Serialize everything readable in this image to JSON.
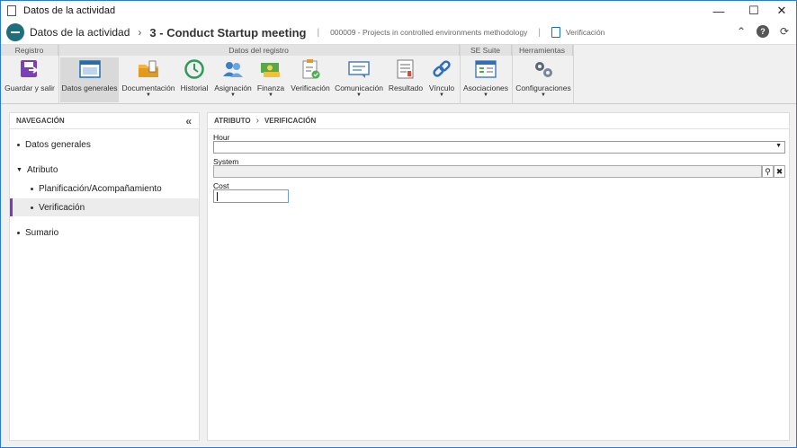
{
  "window": {
    "title": "Datos de la actividad"
  },
  "header": {
    "breadcrumb_root": "Datos de la actividad",
    "record_title": "3 - Conduct Startup meeting",
    "project": "000009 - Projects in controlled environments methodology",
    "section": "Verificación"
  },
  "ribbon": {
    "groups": [
      "Registro",
      "Datos del registro",
      "SE Suite",
      "Herramientas"
    ],
    "buttons": [
      {
        "label": "Guardar y salir",
        "icon": "save-exit-icon"
      },
      {
        "label": "Datos generales",
        "icon": "window-icon"
      },
      {
        "label": "Documentación",
        "icon": "folder-icon"
      },
      {
        "label": "Historial",
        "icon": "history-icon"
      },
      {
        "label": "Asignación",
        "icon": "users-icon"
      },
      {
        "label": "Finanza",
        "icon": "money-icon"
      },
      {
        "label": "Verificación",
        "icon": "checklist-icon"
      },
      {
        "label": "Comunicación",
        "icon": "message-icon"
      },
      {
        "label": "Resultado",
        "icon": "report-icon"
      },
      {
        "label": "Vínculo",
        "icon": "link-icon"
      },
      {
        "label": "Asociaciones",
        "icon": "associations-icon"
      },
      {
        "label": "Configuraciones",
        "icon": "gears-icon"
      }
    ]
  },
  "nav": {
    "title": "NAVEGACIÓN",
    "items": [
      {
        "label": "Datos generales"
      },
      {
        "label": "Atributo"
      },
      {
        "label": "Planificación/Acompañamiento"
      },
      {
        "label": "Verificación"
      },
      {
        "label": "Sumario"
      }
    ]
  },
  "main": {
    "crumb_parent": "ATRIBUTO",
    "crumb_current": "VERIFICACIÓN",
    "fields": {
      "hour_label": "Hour",
      "hour_value": "",
      "system_label": "System",
      "system_value": "",
      "cost_label": "Cost",
      "cost_value": ""
    }
  },
  "colors": {
    "accent_purple": "#7a3bbf",
    "logo_teal": "#1f6e80",
    "window_border": "#2b7bd6"
  }
}
